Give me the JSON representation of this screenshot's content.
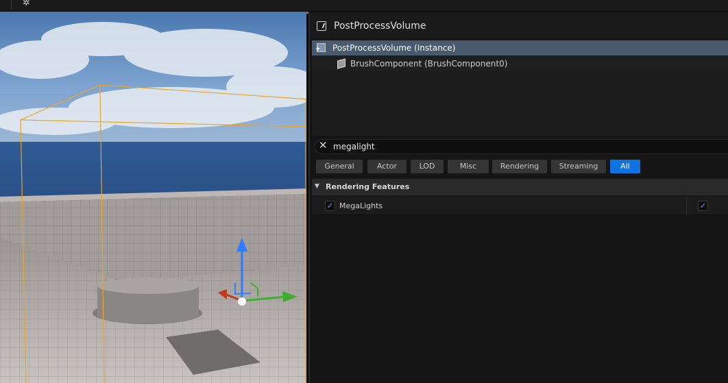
{
  "topbar": {
    "icon": "settings-star-icon"
  },
  "details": {
    "title": "PostProcessVolume",
    "tree": [
      {
        "label": "PostProcessVolume (Instance)",
        "icon": "actor-instance-icon",
        "selected": true
      },
      {
        "label": "BrushComponent (BrushComponent0)",
        "icon": "brush-component-icon",
        "selected": false
      }
    ],
    "search": {
      "value": "megalight",
      "clear_icon": "close-icon"
    },
    "filters": [
      "General",
      "Actor",
      "LOD",
      "Misc",
      "Rendering",
      "Streaming",
      "All"
    ],
    "active_filter": "All",
    "category": {
      "label": "Rendering Features",
      "expanded": true
    },
    "property": {
      "label": "MegaLights",
      "checked": true,
      "value_checked": true
    }
  },
  "colors": {
    "accent": "#0e72e0",
    "selection": "#4a5a6e",
    "check": "#3d8fff"
  }
}
